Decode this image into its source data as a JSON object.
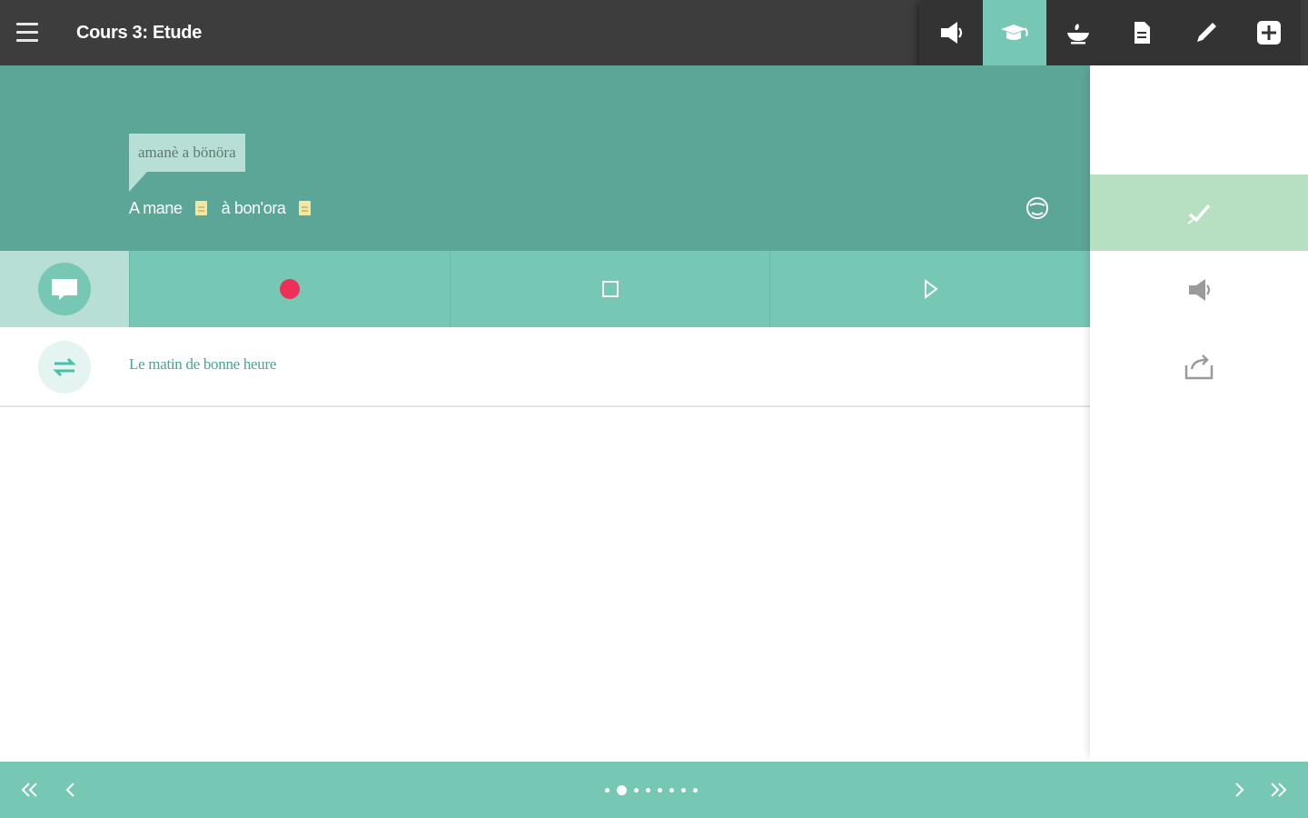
{
  "app": {
    "title": "Cours 3: Etude"
  },
  "toolbar": {
    "items": [
      {
        "name": "audio-tool",
        "icon": "speaker-icon",
        "active": false
      },
      {
        "name": "study-tool",
        "icon": "graduation-cap-icon",
        "active": true
      },
      {
        "name": "meal-tool",
        "icon": "bowl-icon",
        "active": false
      },
      {
        "name": "document-tool",
        "icon": "document-icon",
        "active": false
      },
      {
        "name": "pen-tool",
        "icon": "pen-icon",
        "active": false
      },
      {
        "name": "add-tool",
        "icon": "plus-icon",
        "active": false
      }
    ]
  },
  "lesson": {
    "bubble_text": "amanè a bönöra",
    "words": [
      {
        "text": "A mane"
      },
      {
        "text": "à bon'ora"
      }
    ],
    "translation": "Le matin de bonne heure"
  },
  "recorder": {
    "buttons": [
      "record",
      "stop",
      "play"
    ]
  },
  "side_panel": {
    "buttons": [
      {
        "name": "check-button",
        "icon": "check-icon",
        "active": true
      },
      {
        "name": "listen-button",
        "icon": "speaker-icon",
        "active": false
      },
      {
        "name": "share-button",
        "icon": "share-icon",
        "active": false
      }
    ]
  },
  "pagination": {
    "total": 8,
    "current": 2
  },
  "colors": {
    "topbar": "#3d3d3d",
    "teal_dark": "#5ca697",
    "teal": "#76c8b4",
    "teal_light": "#b8dfd5",
    "record_red": "#ee2f5a",
    "check_green": "#b7dfc1"
  }
}
